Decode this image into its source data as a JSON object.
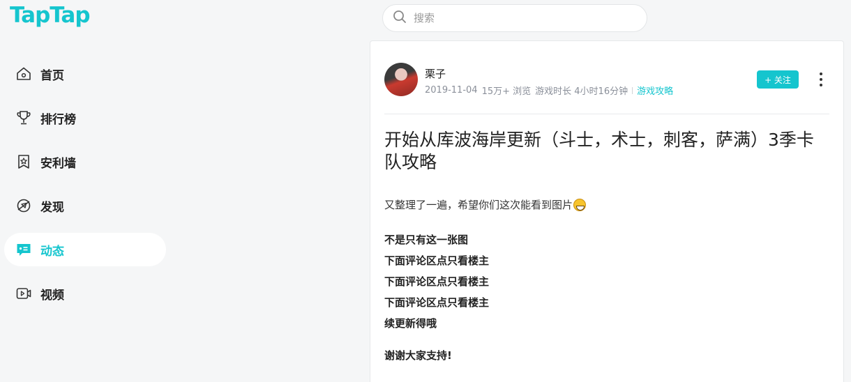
{
  "logo": "TapTap",
  "search": {
    "placeholder": "搜索"
  },
  "sidebar": {
    "items": [
      {
        "label": "首页",
        "icon": "home-icon"
      },
      {
        "label": "排行榜",
        "icon": "trophy-icon"
      },
      {
        "label": "安利墙",
        "icon": "recommend-badge-icon"
      },
      {
        "label": "发现",
        "icon": "compass-icon"
      },
      {
        "label": "动态",
        "icon": "chat-feed-icon",
        "active": true
      },
      {
        "label": "视频",
        "icon": "video-icon"
      }
    ]
  },
  "post": {
    "author": "栗子",
    "date": "2019-11-04",
    "views": "15万+ 浏览",
    "playtime": "游戏时长 4小时16分钟",
    "tag": "游戏攻略",
    "follow_label": "+ 关注",
    "title": "开始从库波海岸更新（斗士，术士，刺客，萨满）3季卡队攻略",
    "intro": "又整理了一遍，希望你们这次能看到图片",
    "lines": [
      "不是只有这一张图",
      "下面评论区点只看楼主",
      "下面评论区点只看楼主",
      "下面评论区点只看楼主",
      "续更新得哦"
    ],
    "thanks": "谢谢大家支持!"
  },
  "colors": {
    "accent": "#15c5ce",
    "background": "#f5f6f7"
  }
}
